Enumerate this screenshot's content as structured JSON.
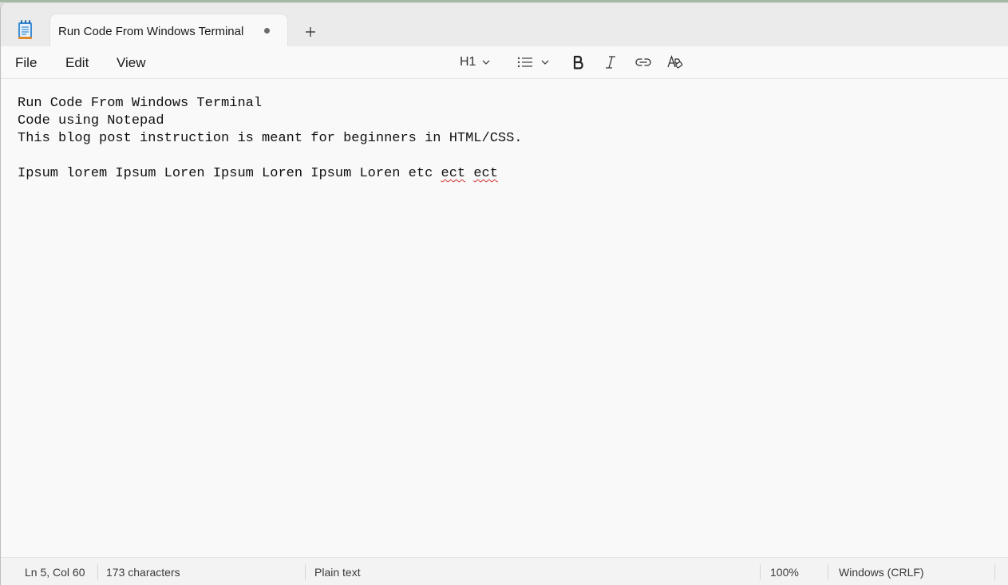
{
  "window": {
    "tab_title": "Run Code From Windows Terminal",
    "app_icon": "notepad-icon",
    "unsaved_indicator": "dot",
    "new_tab_icon": "plus-icon"
  },
  "menu": {
    "file": "File",
    "edit": "Edit",
    "view": "View"
  },
  "format_toolbar": {
    "heading": "H1",
    "list_icon": "list-icon",
    "bold_icon": "bold-icon",
    "italic_icon": "italic-icon",
    "link_icon": "link-icon",
    "clear_format_icon": "clear-formatting-icon"
  },
  "editor": {
    "lines": [
      "Run Code From Windows Terminal",
      "Code using Notepad",
      "This blog post instruction is meant for beginners in HTML/CSS.",
      "",
      "Ipsum lorem Ipsum Loren Ipsum Loren Ipsum Loren etc "
    ],
    "misspelled_1": "ect",
    "misspelled_2": "ect"
  },
  "status": {
    "position": "Ln 5, Col 60",
    "characters": "173 characters",
    "format": "Plain text",
    "zoom": "100%",
    "line_ending": "Windows (CRLF)"
  },
  "colors": {
    "background": "#f9f9f9",
    "tabbar": "#ebebeb",
    "spellcheck": "#d32f2f"
  }
}
